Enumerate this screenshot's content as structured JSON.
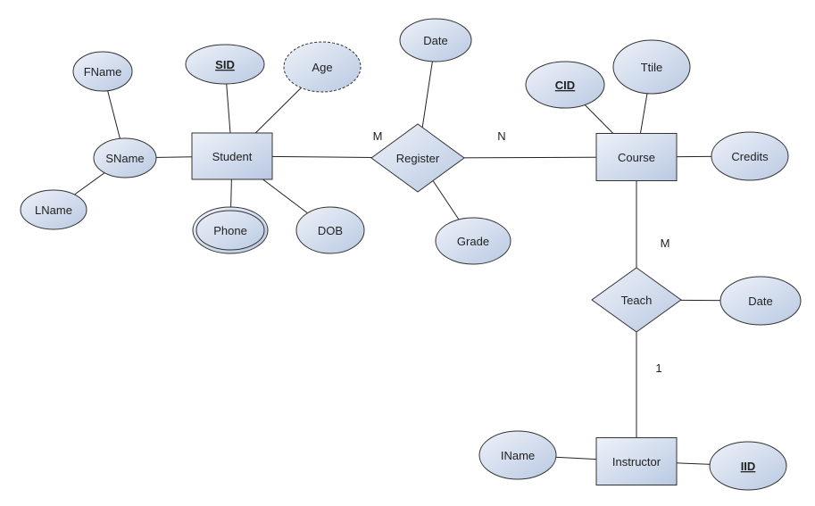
{
  "colors": {
    "fill_light": "#eef2f9",
    "fill_dark": "#b9c9e2",
    "stroke": "#333333",
    "line": "#222222"
  },
  "nodes": [
    {
      "id": "fname",
      "label": "FName",
      "kind": "attribute"
    },
    {
      "id": "sname",
      "label": "SName",
      "kind": "attribute"
    },
    {
      "id": "lname",
      "label": "LName",
      "kind": "attribute"
    },
    {
      "id": "sid",
      "label": "SID",
      "kind": "key-attribute"
    },
    {
      "id": "age",
      "label": "Age",
      "kind": "derived-attribute"
    },
    {
      "id": "student",
      "label": "Student",
      "kind": "entity"
    },
    {
      "id": "phone",
      "label": "Phone",
      "kind": "multivalued-attribute"
    },
    {
      "id": "dob",
      "label": "DOB",
      "kind": "attribute"
    },
    {
      "id": "regdate",
      "label": "Date",
      "kind": "attribute"
    },
    {
      "id": "register",
      "label": "Register",
      "kind": "relationship"
    },
    {
      "id": "grade",
      "label": "Grade",
      "kind": "attribute"
    },
    {
      "id": "cid",
      "label": "CID",
      "kind": "key-attribute"
    },
    {
      "id": "title",
      "label": "Ttile",
      "kind": "attribute"
    },
    {
      "id": "course",
      "label": "Course",
      "kind": "entity"
    },
    {
      "id": "credits",
      "label": "Credits",
      "kind": "attribute"
    },
    {
      "id": "teach",
      "label": "Teach",
      "kind": "relationship"
    },
    {
      "id": "teachdate",
      "label": "Date",
      "kind": "attribute"
    },
    {
      "id": "instructor",
      "label": "Instructor",
      "kind": "entity"
    },
    {
      "id": "iname",
      "label": "IName",
      "kind": "attribute"
    },
    {
      "id": "iid",
      "label": "IID",
      "kind": "key-attribute"
    }
  ],
  "edges": [
    {
      "from": "fname",
      "to": "sname"
    },
    {
      "from": "lname",
      "to": "sname"
    },
    {
      "from": "sname",
      "to": "student"
    },
    {
      "from": "sid",
      "to": "student"
    },
    {
      "from": "age",
      "to": "student"
    },
    {
      "from": "phone",
      "to": "student"
    },
    {
      "from": "dob",
      "to": "student"
    },
    {
      "from": "student",
      "to": "register",
      "cardinality": "M"
    },
    {
      "from": "register",
      "to": "course",
      "cardinality": "N"
    },
    {
      "from": "regdate",
      "to": "register"
    },
    {
      "from": "grade",
      "to": "register"
    },
    {
      "from": "cid",
      "to": "course"
    },
    {
      "from": "title",
      "to": "course"
    },
    {
      "from": "credits",
      "to": "course"
    },
    {
      "from": "course",
      "to": "teach",
      "cardinality": "M"
    },
    {
      "from": "teachdate",
      "to": "teach"
    },
    {
      "from": "teach",
      "to": "instructor",
      "cardinality": "1"
    },
    {
      "from": "iname",
      "to": "instructor"
    },
    {
      "from": "iid",
      "to": "instructor"
    }
  ]
}
